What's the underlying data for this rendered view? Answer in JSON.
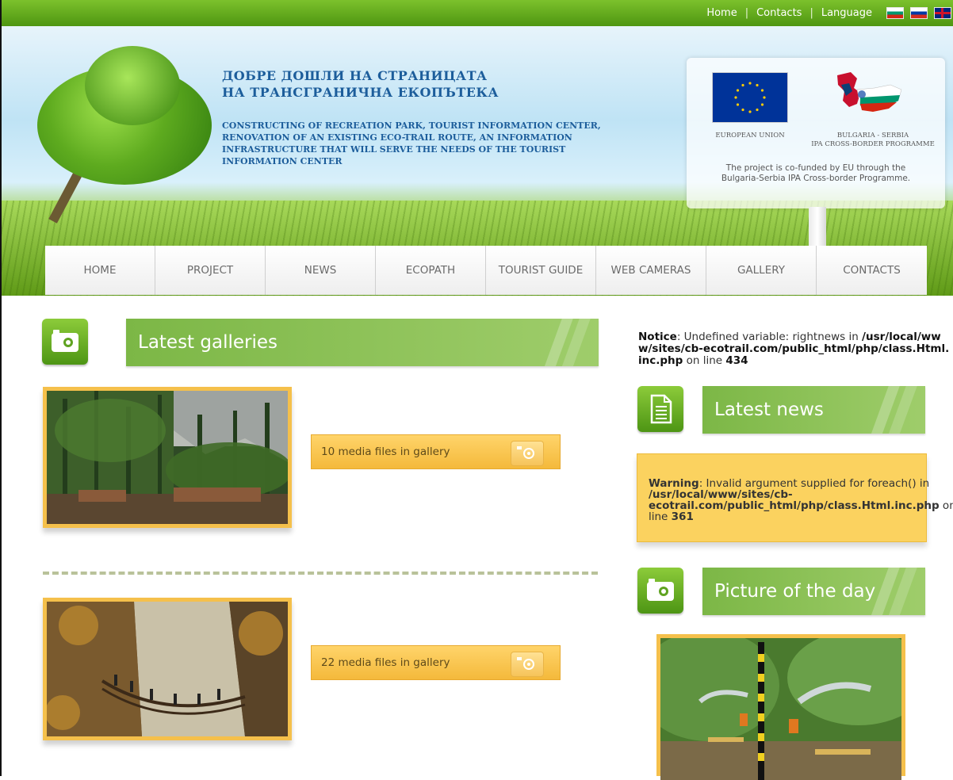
{
  "topbar": {
    "links": [
      "Home",
      "Contacts",
      "Language"
    ],
    "flags": [
      "bulgarian-flag-icon",
      "russian-flag-icon",
      "uk-flag-icon"
    ]
  },
  "header": {
    "title_line1": "ДОБРЕ ДОШЛИ НА СТРАНИЦАТА",
    "title_line2": "НА ТРАНСГРАНИЧНА ЕКОПЪТЕКА",
    "subtitle_lines": [
      "CONSTRUCTING OF RECREATION PARK, TOURIST INFORMATION CENTER,",
      "RENOVATION OF AN EXISTING ECO-TRAIL ROUTE, AN INFORMATION",
      "INFRASTRUCTURE THAT WILL SERVE THE NEEDS OF THE TOURIST",
      "INFORMATION CENTER"
    ],
    "eu_label": "EUROPEAN UNION",
    "ipa_label_line1": "BULGARIA - SERBIA",
    "ipa_label_line2": "IPA CROSS-BORDER PROGRAMME",
    "cofund_line1": "The project is co-funded by EU through the",
    "cofund_line2": "Bulgaria-Serbia IPA Cross-border Programme."
  },
  "nav": {
    "items": [
      "HOME",
      "PROJECT",
      "NEWS",
      "ECOPATH",
      "TOURIST GUIDE",
      "WEB CAMERAS",
      "GALLERY",
      "CONTACTS"
    ]
  },
  "galleries": {
    "heading": "Latest galleries",
    "items": [
      {
        "media_text": "10 media files in gallery"
      },
      {
        "media_text": "22 media files in gallery"
      }
    ]
  },
  "notice": {
    "label": "Notice",
    "text1": ": Undefined variable: rightnews in",
    "path": "/usr/local/www/sites/cb-ecotrail.com/public_html/php/class.Html.inc.php",
    "text2": " on line ",
    "line": "434"
  },
  "latest_news": {
    "heading": "Latest news"
  },
  "warning": {
    "label": "Warning",
    "text1": ": Invalid argument supplied for foreach() in ",
    "path": "/usr/local/www/sites/cb-ecotrail.com/public_html/php/class.Html.inc.php",
    "text2": " on line ",
    "line": "361"
  },
  "picture_of_day": {
    "heading": "Picture of the day"
  },
  "colors": {
    "accent_green": "#7cb746",
    "accent_yellow": "#fbd25f",
    "title_blue": "#1c5d9b"
  }
}
